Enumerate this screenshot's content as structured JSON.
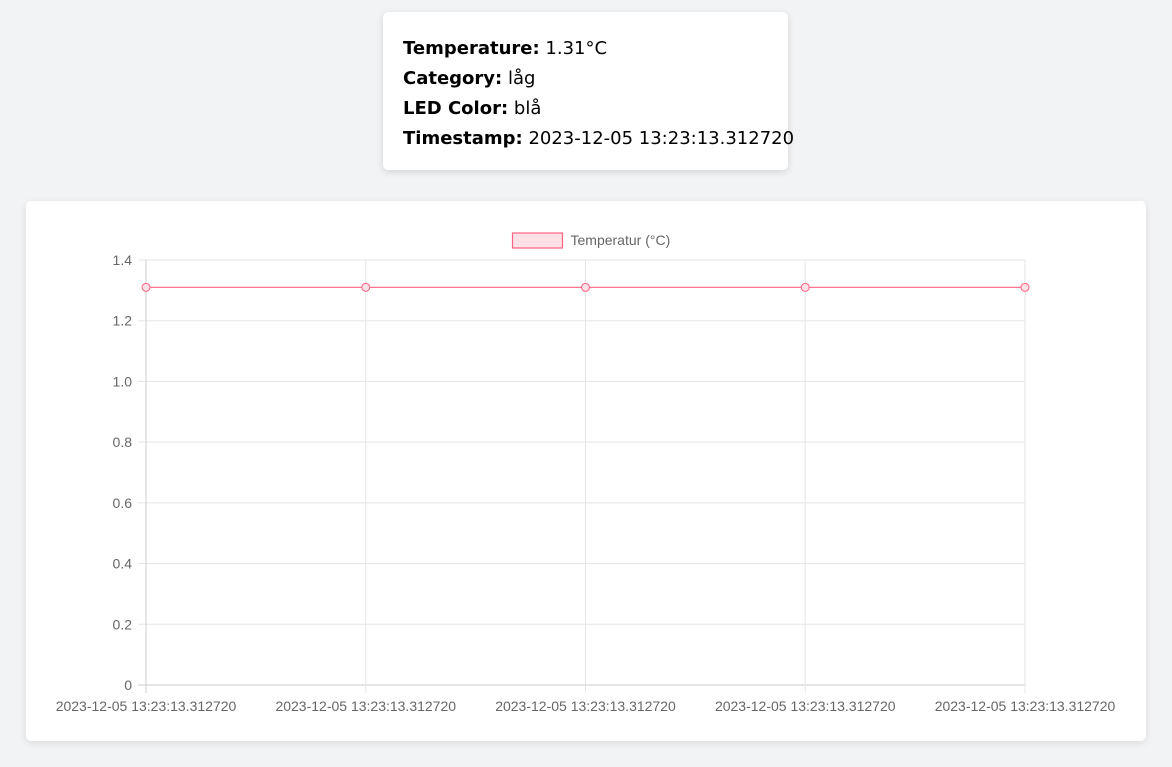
{
  "info": {
    "temperature_label": "Temperature:",
    "temperature_value": "1.31°C",
    "category_label": "Category:",
    "category_value": "låg",
    "led_label": "LED Color:",
    "led_value": "blå",
    "timestamp_label": "Timestamp:",
    "timestamp_value": "2023-12-05 13:23:13.312720"
  },
  "chart_data": {
    "type": "line",
    "categories": [
      "2023-12-05 13:23:13.312720",
      "2023-12-05 13:23:13.312720",
      "2023-12-05 13:23:13.312720",
      "2023-12-05 13:23:13.312720",
      "2023-12-05 13:23:13.312720"
    ],
    "series": [
      {
        "name": "Temperatur (°C)",
        "values": [
          1.31,
          1.31,
          1.31,
          1.31,
          1.31
        ],
        "color": "#ff6384",
        "fill": "#ffe0e6"
      }
    ],
    "ylim": [
      0,
      1.4
    ],
    "yticks": [
      "0",
      "0.2",
      "0.4",
      "0.6",
      "0.8",
      "1.0",
      "1.2",
      "1.4"
    ],
    "legend": "top-center",
    "grid": true,
    "grid_color": "#e5e5e5",
    "axis_color": "#cccccc"
  }
}
